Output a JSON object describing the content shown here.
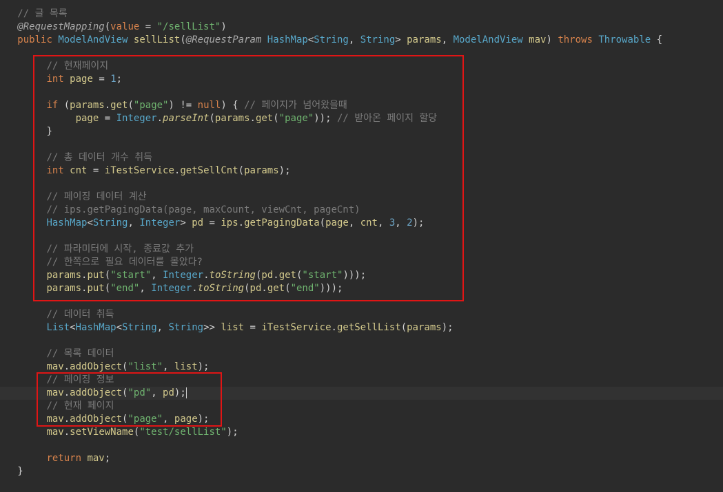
{
  "code_lines": [
    {
      "indent": "   ",
      "tokens": [
        {
          "c": "t-comment",
          "t": "// 글 목록"
        }
      ]
    },
    {
      "indent": "   ",
      "tokens": [
        {
          "c": "t-anno",
          "t": "@RequestMapping"
        },
        {
          "c": "t-plain",
          "t": "("
        },
        {
          "c": "t-kw",
          "t": "value"
        },
        {
          "c": "t-plain",
          "t": " = "
        },
        {
          "c": "t-str",
          "t": "\"/sellList\""
        },
        {
          "c": "t-plain",
          "t": ")"
        }
      ]
    },
    {
      "indent": "   ",
      "tokens": [
        {
          "c": "t-kw",
          "t": "public"
        },
        {
          "c": "t-plain",
          "t": " "
        },
        {
          "c": "t-type",
          "t": "ModelAndView"
        },
        {
          "c": "t-plain",
          "t": " "
        },
        {
          "c": "t-id",
          "t": "sellList"
        },
        {
          "c": "t-plain",
          "t": "("
        },
        {
          "c": "t-anno",
          "t": "@RequestParam"
        },
        {
          "c": "t-plain",
          "t": " "
        },
        {
          "c": "t-type",
          "t": "HashMap"
        },
        {
          "c": "t-plain",
          "t": "<"
        },
        {
          "c": "t-type",
          "t": "String"
        },
        {
          "c": "t-plain",
          "t": ", "
        },
        {
          "c": "t-type",
          "t": "String"
        },
        {
          "c": "t-plain",
          "t": "> "
        },
        {
          "c": "t-id",
          "t": "params"
        },
        {
          "c": "t-plain",
          "t": ", "
        },
        {
          "c": "t-type",
          "t": "ModelAndView"
        },
        {
          "c": "t-plain",
          "t": " "
        },
        {
          "c": "t-id",
          "t": "mav"
        },
        {
          "c": "t-plain",
          "t": ") "
        },
        {
          "c": "t-kw",
          "t": "throws"
        },
        {
          "c": "t-plain",
          "t": " "
        },
        {
          "c": "t-type",
          "t": "Throwable"
        },
        {
          "c": "t-plain",
          "t": " {"
        }
      ]
    },
    {
      "indent": "",
      "tokens": []
    },
    {
      "indent": "        ",
      "tokens": [
        {
          "c": "t-comment",
          "t": "// 현재페이지"
        }
      ]
    },
    {
      "indent": "        ",
      "tokens": [
        {
          "c": "t-kw",
          "t": "int"
        },
        {
          "c": "t-plain",
          "t": " "
        },
        {
          "c": "t-id",
          "t": "page"
        },
        {
          "c": "t-plain",
          "t": " = "
        },
        {
          "c": "t-num",
          "t": "1"
        },
        {
          "c": "t-plain",
          "t": ";"
        }
      ]
    },
    {
      "indent": "",
      "tokens": []
    },
    {
      "indent": "        ",
      "tokens": [
        {
          "c": "t-kw",
          "t": "if"
        },
        {
          "c": "t-plain",
          "t": " ("
        },
        {
          "c": "t-id",
          "t": "params"
        },
        {
          "c": "t-plain",
          "t": "."
        },
        {
          "c": "t-id",
          "t": "get"
        },
        {
          "c": "t-plain",
          "t": "("
        },
        {
          "c": "t-str",
          "t": "\"page\""
        },
        {
          "c": "t-plain",
          "t": ") != "
        },
        {
          "c": "t-kw",
          "t": "null"
        },
        {
          "c": "t-plain",
          "t": ") { "
        },
        {
          "c": "t-comment",
          "t": "// 페이지가 넘어왔을때"
        }
      ]
    },
    {
      "indent": "             ",
      "tokens": [
        {
          "c": "t-id",
          "t": "page"
        },
        {
          "c": "t-plain",
          "t": " = "
        },
        {
          "c": "t-type",
          "t": "Integer"
        },
        {
          "c": "t-plain",
          "t": "."
        },
        {
          "c": "t-ital2",
          "t": "parseInt"
        },
        {
          "c": "t-plain",
          "t": "("
        },
        {
          "c": "t-id",
          "t": "params"
        },
        {
          "c": "t-plain",
          "t": "."
        },
        {
          "c": "t-id",
          "t": "get"
        },
        {
          "c": "t-plain",
          "t": "("
        },
        {
          "c": "t-str",
          "t": "\"page\""
        },
        {
          "c": "t-plain",
          "t": ")); "
        },
        {
          "c": "t-comment",
          "t": "// 받아온 페이지 할당"
        }
      ]
    },
    {
      "indent": "        ",
      "tokens": [
        {
          "c": "t-plain",
          "t": "}"
        }
      ]
    },
    {
      "indent": "",
      "tokens": []
    },
    {
      "indent": "        ",
      "tokens": [
        {
          "c": "t-comment",
          "t": "// 총 데이터 개수 취득"
        }
      ]
    },
    {
      "indent": "        ",
      "tokens": [
        {
          "c": "t-kw",
          "t": "int"
        },
        {
          "c": "t-plain",
          "t": " "
        },
        {
          "c": "t-id",
          "t": "cnt"
        },
        {
          "c": "t-plain",
          "t": " = "
        },
        {
          "c": "t-id",
          "t": "iTestService"
        },
        {
          "c": "t-plain",
          "t": "."
        },
        {
          "c": "t-id",
          "t": "getSellCnt"
        },
        {
          "c": "t-plain",
          "t": "("
        },
        {
          "c": "t-id",
          "t": "params"
        },
        {
          "c": "t-plain",
          "t": ");"
        }
      ]
    },
    {
      "indent": "",
      "tokens": []
    },
    {
      "indent": "        ",
      "tokens": [
        {
          "c": "t-comment",
          "t": "// 페이징 데이터 계산"
        }
      ]
    },
    {
      "indent": "        ",
      "tokens": [
        {
          "c": "t-comment",
          "t": "// ips.getPagingData(page, maxCount, viewCnt, pageCnt)"
        }
      ]
    },
    {
      "indent": "        ",
      "tokens": [
        {
          "c": "t-type",
          "t": "HashMap"
        },
        {
          "c": "t-plain",
          "t": "<"
        },
        {
          "c": "t-type",
          "t": "String"
        },
        {
          "c": "t-plain",
          "t": ", "
        },
        {
          "c": "t-type",
          "t": "Integer"
        },
        {
          "c": "t-plain",
          "t": "> "
        },
        {
          "c": "t-id",
          "t": "pd"
        },
        {
          "c": "t-plain",
          "t": " = "
        },
        {
          "c": "t-id",
          "t": "ips"
        },
        {
          "c": "t-plain",
          "t": "."
        },
        {
          "c": "t-id",
          "t": "getPagingData"
        },
        {
          "c": "t-plain",
          "t": "("
        },
        {
          "c": "t-id",
          "t": "page"
        },
        {
          "c": "t-plain",
          "t": ", "
        },
        {
          "c": "t-id",
          "t": "cnt"
        },
        {
          "c": "t-plain",
          "t": ", "
        },
        {
          "c": "t-num",
          "t": "3"
        },
        {
          "c": "t-plain",
          "t": ", "
        },
        {
          "c": "t-num",
          "t": "2"
        },
        {
          "c": "t-plain",
          "t": ");"
        }
      ]
    },
    {
      "indent": "",
      "tokens": []
    },
    {
      "indent": "        ",
      "tokens": [
        {
          "c": "t-comment",
          "t": "// 파라미터에 시작, 종료값 추가"
        }
      ]
    },
    {
      "indent": "        ",
      "tokens": [
        {
          "c": "t-comment",
          "t": "// 한쪽으로 필요 데이터를 몰았다?"
        }
      ]
    },
    {
      "indent": "        ",
      "tokens": [
        {
          "c": "t-id",
          "t": "params"
        },
        {
          "c": "t-plain",
          "t": "."
        },
        {
          "c": "t-id",
          "t": "put"
        },
        {
          "c": "t-plain",
          "t": "("
        },
        {
          "c": "t-str",
          "t": "\"start\""
        },
        {
          "c": "t-plain",
          "t": ", "
        },
        {
          "c": "t-type",
          "t": "Integer"
        },
        {
          "c": "t-plain",
          "t": "."
        },
        {
          "c": "t-ital2",
          "t": "toString"
        },
        {
          "c": "t-plain",
          "t": "("
        },
        {
          "c": "t-id",
          "t": "pd"
        },
        {
          "c": "t-plain",
          "t": "."
        },
        {
          "c": "t-id",
          "t": "get"
        },
        {
          "c": "t-plain",
          "t": "("
        },
        {
          "c": "t-str",
          "t": "\"start\""
        },
        {
          "c": "t-plain",
          "t": ")));"
        }
      ]
    },
    {
      "indent": "        ",
      "tokens": [
        {
          "c": "t-id",
          "t": "params"
        },
        {
          "c": "t-plain",
          "t": "."
        },
        {
          "c": "t-id",
          "t": "put"
        },
        {
          "c": "t-plain",
          "t": "("
        },
        {
          "c": "t-str",
          "t": "\"end\""
        },
        {
          "c": "t-plain",
          "t": ", "
        },
        {
          "c": "t-type",
          "t": "Integer"
        },
        {
          "c": "t-plain",
          "t": "."
        },
        {
          "c": "t-ital2",
          "t": "toString"
        },
        {
          "c": "t-plain",
          "t": "("
        },
        {
          "c": "t-id",
          "t": "pd"
        },
        {
          "c": "t-plain",
          "t": "."
        },
        {
          "c": "t-id",
          "t": "get"
        },
        {
          "c": "t-plain",
          "t": "("
        },
        {
          "c": "t-str",
          "t": "\"end\""
        },
        {
          "c": "t-plain",
          "t": ")));"
        }
      ]
    },
    {
      "indent": "",
      "tokens": []
    },
    {
      "indent": "        ",
      "tokens": [
        {
          "c": "t-comment",
          "t": "// 데이터 취득"
        }
      ]
    },
    {
      "indent": "        ",
      "tokens": [
        {
          "c": "t-type",
          "t": "List"
        },
        {
          "c": "t-plain",
          "t": "<"
        },
        {
          "c": "t-type",
          "t": "HashMap"
        },
        {
          "c": "t-plain",
          "t": "<"
        },
        {
          "c": "t-type",
          "t": "String"
        },
        {
          "c": "t-plain",
          "t": ", "
        },
        {
          "c": "t-type",
          "t": "String"
        },
        {
          "c": "t-plain",
          "t": ">> "
        },
        {
          "c": "t-id",
          "t": "list"
        },
        {
          "c": "t-plain",
          "t": " = "
        },
        {
          "c": "t-id",
          "t": "iTestService"
        },
        {
          "c": "t-plain",
          "t": "."
        },
        {
          "c": "t-id",
          "t": "getSellList"
        },
        {
          "c": "t-plain",
          "t": "("
        },
        {
          "c": "t-id",
          "t": "params"
        },
        {
          "c": "t-plain",
          "t": ");"
        }
      ]
    },
    {
      "indent": "",
      "tokens": []
    },
    {
      "indent": "        ",
      "tokens": [
        {
          "c": "t-comment",
          "t": "// 목록 데이터"
        }
      ]
    },
    {
      "indent": "        ",
      "tokens": [
        {
          "c": "t-id",
          "t": "mav"
        },
        {
          "c": "t-plain",
          "t": "."
        },
        {
          "c": "t-id",
          "t": "addObject"
        },
        {
          "c": "t-plain",
          "t": "("
        },
        {
          "c": "t-str",
          "t": "\"list\""
        },
        {
          "c": "t-plain",
          "t": ", "
        },
        {
          "c": "t-id",
          "t": "list"
        },
        {
          "c": "t-plain",
          "t": ");"
        }
      ]
    },
    {
      "indent": "        ",
      "tokens": [
        {
          "c": "t-comment",
          "t": "// 페이징 정보"
        }
      ]
    },
    {
      "indent": "        ",
      "current": true,
      "tokens": [
        {
          "c": "t-id",
          "t": "mav"
        },
        {
          "c": "t-plain",
          "t": "."
        },
        {
          "c": "t-id",
          "t": "addObject"
        },
        {
          "c": "t-plain",
          "t": "("
        },
        {
          "c": "t-str",
          "t": "\"pd\""
        },
        {
          "c": "t-plain",
          "t": ", "
        },
        {
          "c": "t-id",
          "t": "pd"
        },
        {
          "c": "t-plain",
          "t": ");"
        }
      ]
    },
    {
      "indent": "        ",
      "tokens": [
        {
          "c": "t-comment",
          "t": "// 현재 페이지"
        }
      ]
    },
    {
      "indent": "        ",
      "tokens": [
        {
          "c": "t-id",
          "t": "mav"
        },
        {
          "c": "t-plain",
          "t": "."
        },
        {
          "c": "t-id",
          "t": "addObject"
        },
        {
          "c": "t-plain",
          "t": "("
        },
        {
          "c": "t-str",
          "t": "\"page\""
        },
        {
          "c": "t-plain",
          "t": ", "
        },
        {
          "c": "t-id",
          "t": "page"
        },
        {
          "c": "t-plain",
          "t": ");"
        }
      ]
    },
    {
      "indent": "        ",
      "tokens": [
        {
          "c": "t-id",
          "t": "mav"
        },
        {
          "c": "t-plain",
          "t": "."
        },
        {
          "c": "t-id",
          "t": "setViewName"
        },
        {
          "c": "t-plain",
          "t": "("
        },
        {
          "c": "t-str",
          "t": "\"test/sellList\""
        },
        {
          "c": "t-plain",
          "t": ");"
        }
      ]
    },
    {
      "indent": "",
      "tokens": []
    },
    {
      "indent": "        ",
      "tokens": [
        {
          "c": "t-kw",
          "t": "return"
        },
        {
          "c": "t-plain",
          "t": " "
        },
        {
          "c": "t-id",
          "t": "mav"
        },
        {
          "c": "t-plain",
          "t": ";"
        }
      ]
    },
    {
      "indent": "   ",
      "tokens": [
        {
          "c": "t-plain",
          "t": "}"
        }
      ]
    }
  ],
  "colors": {
    "background": "#2b2b2b",
    "current_line": "#323232",
    "highlight_box": "#e01515"
  }
}
